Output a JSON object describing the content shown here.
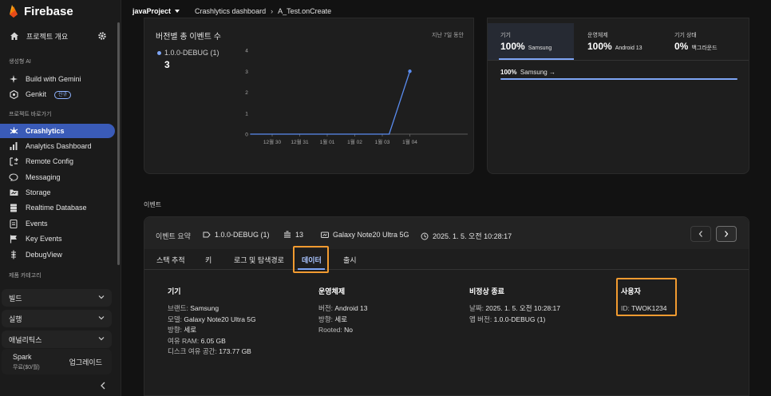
{
  "app": {
    "name": "Firebase"
  },
  "topbar": {
    "project": "javaProject",
    "crumbs": [
      "Crashlytics dashboard",
      "A_Test.onCreate"
    ]
  },
  "sidebar": {
    "project_overview": "프로젝트 개요",
    "section_genai": "생성형 AI",
    "genai_items": [
      {
        "label": "Build with Gemini",
        "icon": "sparkle-icon"
      },
      {
        "label": "Genkit",
        "icon": "genkit-icon",
        "badge": "신규"
      }
    ],
    "section_shortcuts": "프로젝트 바로가기",
    "shortcut_items": [
      {
        "label": "Crashlytics",
        "icon": "crashlytics-icon",
        "active": true
      },
      {
        "label": "Analytics Dashboard",
        "icon": "bar-chart-icon"
      },
      {
        "label": "Remote Config",
        "icon": "remote-config-icon"
      },
      {
        "label": "Messaging",
        "icon": "messaging-icon"
      },
      {
        "label": "Storage",
        "icon": "folder-icon"
      },
      {
        "label": "Realtime Database",
        "icon": "database-icon"
      },
      {
        "label": "Events",
        "icon": "events-icon"
      },
      {
        "label": "Key Events",
        "icon": "flag-icon"
      },
      {
        "label": "DebugView",
        "icon": "debug-icon"
      }
    ],
    "section_categories": "제품 카테고리",
    "categories": [
      "빌드",
      "실행",
      "애널리틱스"
    ],
    "plan": {
      "name": "Spark",
      "price": "무료($0/월)",
      "upgrade": "업그레이드"
    }
  },
  "chart_card": {
    "title": "버전별 총 이벤트 수",
    "period": "지난 7일 동안",
    "legend_label": "1.0.0-DEBUG (1)",
    "total": "3"
  },
  "chart_data": {
    "type": "line",
    "categories": [
      "12월 30",
      "12월 31",
      "1월 01",
      "1월 02",
      "1월 03",
      "1월 04"
    ],
    "y_ticks": [
      "0",
      "1",
      "2",
      "3",
      "4"
    ],
    "ylim": [
      0,
      4
    ],
    "series": [
      {
        "name": "1.0.0-DEBUG (1)",
        "color": "#5a8cf0",
        "points": [
          [
            -0.8,
            0
          ],
          [
            0,
            0
          ],
          [
            1,
            0
          ],
          [
            2,
            0
          ],
          [
            3,
            0
          ],
          [
            4,
            0
          ],
          [
            4.25,
            0
          ],
          [
            5,
            3
          ]
        ]
      }
    ]
  },
  "dist_card": {
    "tabs": [
      {
        "title": "기기",
        "value": "100%",
        "sub": "Samsung",
        "selected": true
      },
      {
        "title": "운영체제",
        "value": "100%",
        "sub": "Android 13",
        "selected": false
      },
      {
        "title": "기기 상태",
        "value": "0%",
        "sub": "백그라운드",
        "selected": false
      }
    ],
    "row_percent": "100%",
    "row_label": "Samsung →"
  },
  "events": {
    "section_label": "이벤트",
    "summary_label": "이벤트 요약",
    "version": "1.0.0-DEBUG (1)",
    "count": "13",
    "device": "Galaxy Note20 Ultra 5G",
    "timestamp": "2025. 1. 5. 오전 10:28:17",
    "tabs": [
      "스택 추적",
      "키",
      "로그 및 탐색경로",
      "데이터",
      "출시"
    ],
    "selected_tab": 3,
    "columns": [
      {
        "title": "기기",
        "rows": [
          {
            "k": "브랜드:",
            "v": "Samsung"
          },
          {
            "k": "모델:",
            "v": "Galaxy Note20 Ultra 5G"
          },
          {
            "k": "방향:",
            "v": "세로"
          },
          {
            "k": "여유 RAM:",
            "v": "6.05 GB"
          },
          {
            "k": "디스크 여유 공간:",
            "v": "173.77 GB"
          }
        ]
      },
      {
        "title": "운영체제",
        "rows": [
          {
            "k": "버전:",
            "v": "Android 13"
          },
          {
            "k": "방향:",
            "v": "세로"
          },
          {
            "k": "Rooted:",
            "v": "No"
          }
        ]
      },
      {
        "title": "비정상 종료",
        "rows": [
          {
            "k": "날짜:",
            "v": "2025. 1. 5. 오전 10:28:17"
          },
          {
            "k": "앱 버전:",
            "v": "1.0.0-DEBUG (1)"
          }
        ]
      },
      {
        "title": "사용자",
        "rows": [
          {
            "k": "ID:",
            "v": "TWOK1234"
          }
        ]
      }
    ]
  },
  "colors": {
    "accent": "#7ea5f5",
    "active_nav": "#3a5bb8",
    "highlight": "#f29b30"
  }
}
